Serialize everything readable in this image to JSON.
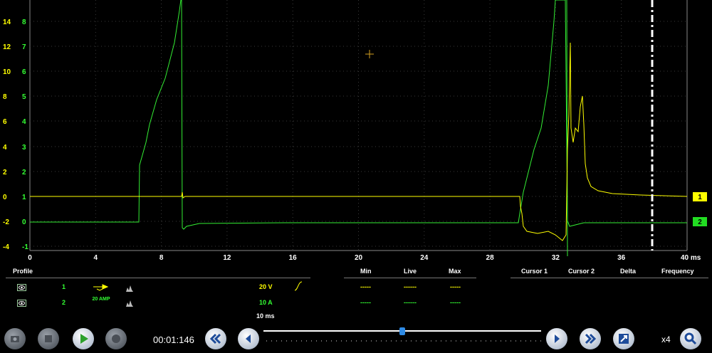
{
  "scope": {
    "x_ticks": [
      "0",
      "4",
      "8",
      "12",
      "16",
      "20",
      "24",
      "28",
      "32",
      "36",
      "40 ms"
    ],
    "y1_ticks": [
      "14",
      "12",
      "10",
      "8",
      "6",
      "4",
      "2",
      "0",
      "-2",
      "-4"
    ],
    "y2_ticks": [
      "8",
      "7",
      "6",
      "5",
      "4",
      "3",
      "2",
      "1",
      "0",
      "-1"
    ],
    "channel_markers": [
      {
        "label": "1",
        "color": "#ffff00"
      },
      {
        "label": "2",
        "color": "#22dd22"
      }
    ],
    "colors": {
      "ch1": "#ffff00",
      "ch2": "#33ee33",
      "grid": "#555555",
      "cursor": "#ffffff"
    }
  },
  "panel": {
    "profile_header": "Profile",
    "min_header": "Min",
    "live_header": "Live",
    "max_header": "Max",
    "cursor1_header": "Cursor 1",
    "cursor2_header": "Cursor 2",
    "delta_header": "Delta",
    "frequency_header": "Frequency",
    "channels": [
      {
        "number": "1",
        "probe_icon": "probe-icon",
        "probe_text": "",
        "scale": "20 V",
        "color": "#ffff00",
        "min": "-----",
        "live": "------",
        "max": "-----"
      },
      {
        "number": "2",
        "probe_icon": "amp-clamp-icon",
        "probe_text": "20 AMP",
        "scale": "10 A",
        "color": "#33ff33",
        "min": "-----",
        "live": "------",
        "max": "-----"
      }
    ],
    "timebase": "10 ms"
  },
  "toolbar": {
    "time": "00:01:146",
    "zoom": "x4",
    "playback_position": 0.5
  }
}
